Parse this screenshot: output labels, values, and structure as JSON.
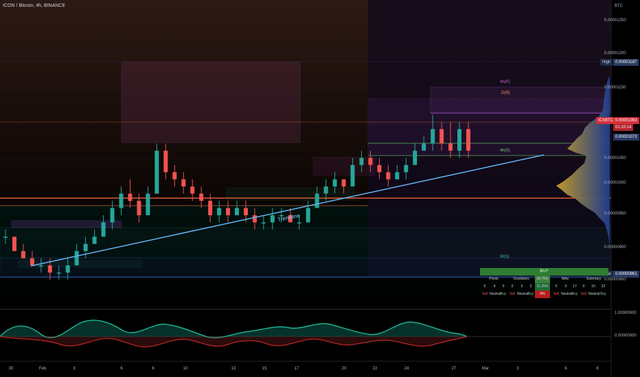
{
  "title": "ICON / Bitcoin, 4h, BINANCE",
  "currency": "BTC",
  "price_axis": [
    "0.00001250",
    "0.00001200",
    "0.00001150",
    "0.00001100",
    "0.00001050",
    "0.00001000",
    "0.00000950",
    "0.00000900",
    "0.00000850"
  ],
  "tags": {
    "high_label": "High",
    "high_value": "0.00001187",
    "symbol": "ICXBTC",
    "last_price": "0.00001093",
    "countdown": "01:10:14",
    "ref_price": "0.00001072",
    "low_label": "Low",
    "low_value": "0.00000861"
  },
  "annotations": {
    "trendline": "Trendline",
    "r4h": "4h(R)",
    "rd": "D(R)",
    "s4h": "4h(S)",
    "s_low": "W(S)"
  },
  "x_axis": [
    "30",
    "Feb",
    "3",
    "6",
    "8",
    "10",
    "13",
    "15",
    "17",
    "20",
    "22",
    "24",
    "27",
    "Mar",
    "3",
    "6",
    "8"
  ],
  "oscillator_axis": [
    "1.00000000",
    "0.00000000"
  ],
  "technical_summary": {
    "signal": "BUY",
    "groups": [
      {
        "name": "Pivots",
        "values": [
          "0",
          "4",
          "0"
        ]
      },
      {
        "name": "Oscillators",
        "badge": "68.75%",
        "values": [
          "0",
          "6",
          "5"
        ],
        "secondary_badge": "31.25%"
      },
      {
        "name": "MAs",
        "values": [
          "0",
          "0",
          "17"
        ]
      },
      {
        "name": "Summary",
        "values": [
          "0",
          "10",
          "22"
        ]
      }
    ],
    "footer": [
      "Sell",
      "Neutral",
      "Buy",
      "Sell",
      "Neutral",
      "Buy",
      "0%",
      "Sell",
      "Neutral",
      "Buy",
      "Sell",
      "Neutral",
      "Buy"
    ]
  },
  "colors": {
    "up": "#26a69a",
    "down": "#ef5350",
    "trendline": "#64b5f6",
    "orange_line": "#ff7043",
    "purple_box": "#8e44ad",
    "buy_green": "#2e7d32"
  },
  "chart_data": {
    "type": "candlestick",
    "symbol": "ICXBTC",
    "interval": "4h",
    "ylim": [
      8.4e-06,
      1.27e-05
    ],
    "candles": [
      [
        9.4e-06,
        9.5e-06,
        9.3e-06,
        9.4e-06
      ],
      [
        9.4e-06,
        9.4e-06,
        9.2e-06,
        9.2e-06
      ],
      [
        9.2e-06,
        9.3e-06,
        9.1e-06,
        9.1e-06
      ],
      [
        9.1e-06,
        9.2e-06,
        9e-06,
        9e-06
      ],
      [
        9e-06,
        9.1e-06,
        8.9e-06,
        9e-06
      ],
      [
        9e-06,
        9.1e-06,
        8.8e-06,
        8.9e-06
      ],
      [
        8.9e-06,
        9e-06,
        8.8e-06,
        8.9e-06
      ],
      [
        8.9e-06,
        9.1e-06,
        8.8e-06,
        9e-06
      ],
      [
        9e-06,
        9.3e-06,
        9e-06,
        9.2e-06
      ],
      [
        9.2e-06,
        9.4e-06,
        9.1e-06,
        9.3e-06
      ],
      [
        9.3e-06,
        9.5e-06,
        9.3e-06,
        9.4e-06
      ],
      [
        9.4e-06,
        9.7e-06,
        9.4e-06,
        9.6e-06
      ],
      [
        9.6e-06,
        9.9e-06,
        9.5e-06,
        9.8e-06
      ],
      [
        9.8e-06,
        1.01e-05,
        9.7e-06,
        1e-05
      ],
      [
        1e-05,
        1.02e-05,
        9.8e-06,
        9.9e-06
      ],
      [
        9.9e-06,
        1e-05,
        9.6e-06,
        9.7e-06
      ],
      [
        9.7e-06,
        1.01e-05,
        9.7e-06,
        1e-05
      ],
      [
        1e-05,
        1.07e-05,
        1e-05,
        1.06e-05
      ],
      [
        1.06e-05,
        1.07e-05,
        1.02e-05,
        1.03e-05
      ],
      [
        1.03e-05,
        1.04e-05,
        1.01e-05,
        1.02e-05
      ],
      [
        1.02e-05,
        1.03e-05,
        1e-05,
        1.01e-05
      ],
      [
        1.01e-05,
        1.02e-05,
        9.9e-06,
        1e-05
      ],
      [
        1e-05,
        1.01e-05,
        9.8e-06,
        9.9e-06
      ],
      [
        9.9e-06,
        1e-05,
        9.6e-06,
        9.7e-06
      ],
      [
        9.7e-06,
        9.9e-06,
        9.6e-06,
        9.8e-06
      ],
      [
        9.8e-06,
        9.9e-06,
        9.6e-06,
        9.7e-06
      ],
      [
        9.7e-06,
        9.9e-06,
        9.7e-06,
        9.8e-06
      ],
      [
        9.8e-06,
        9.9e-06,
        9.6e-06,
        9.7e-06
      ],
      [
        9.7e-06,
        9.8e-06,
        9.5e-06,
        9.6e-06
      ],
      [
        9.6e-06,
        9.7e-06,
        9.5e-06,
        9.6e-06
      ],
      [
        9.6e-06,
        9.8e-06,
        9.5e-06,
        9.7e-06
      ],
      [
        9.7e-06,
        9.8e-06,
        9.6e-06,
        9.7e-06
      ],
      [
        9.7e-06,
        9.8e-06,
        9.6e-06,
        9.6e-06
      ],
      [
        9.6e-06,
        9.7e-06,
        9.5e-06,
        9.6e-06
      ],
      [
        9.6e-06,
        9.9e-06,
        9.6e-06,
        9.8e-06
      ],
      [
        9.8e-06,
        1.01e-05,
        9.8e-06,
        1e-05
      ],
      [
        1e-05,
        1.02e-05,
        9.9e-06,
        1.01e-05
      ],
      [
        1.01e-05,
        1.03e-05,
        1e-05,
        1.02e-05
      ],
      [
        1.02e-05,
        1.02e-05,
        1e-05,
        1.01e-05
      ],
      [
        1.01e-05,
        1.05e-05,
        1.01e-05,
        1.04e-05
      ],
      [
        1.04e-05,
        1.06e-05,
        1.03e-05,
        1.05e-05
      ],
      [
        1.05e-05,
        1.06e-05,
        1.03e-05,
        1.04e-05
      ],
      [
        1.04e-05,
        1.05e-05,
        1.02e-05,
        1.03e-05
      ],
      [
        1.03e-05,
        1.04e-05,
        1.01e-05,
        1.02e-05
      ],
      [
        1.02e-05,
        1.04e-05,
        1.02e-05,
        1.03e-05
      ],
      [
        1.03e-05,
        1.05e-05,
        1.02e-05,
        1.04e-05
      ],
      [
        1.04e-05,
        1.07e-05,
        1.04e-05,
        1.06e-05
      ],
      [
        1.06e-05,
        1.08e-05,
        1.06e-05,
        1.07e-05
      ],
      [
        1.07e-05,
        1.11e-05,
        1.06e-05,
        1.09e-05
      ],
      [
        1.09e-05,
        1.1e-05,
        1.06e-05,
        1.07e-05
      ],
      [
        1.07e-05,
        1.1e-05,
        1.05e-05,
        1.06e-05
      ],
      [
        1.06e-05,
        1.1e-05,
        1.05e-05,
        1.09e-05
      ],
      [
        1.09e-05,
        1.1e-05,
        1.05e-05,
        1.06e-05
      ]
    ]
  }
}
